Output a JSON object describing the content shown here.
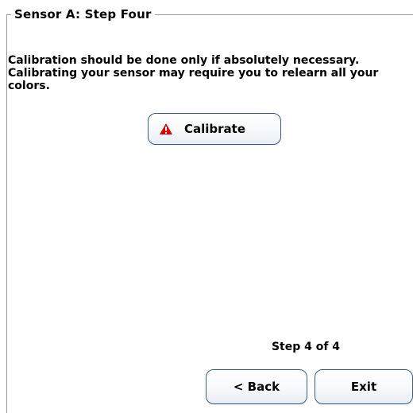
{
  "groupbox": {
    "title": "Sensor A: Step Four"
  },
  "content": {
    "description": "Calibration should be done only if absolutely necessary. Calibrating your sensor may require you to relearn all your colors."
  },
  "calibrate_button": {
    "icon": "warning-icon",
    "icon_color": "#e00000",
    "label": "Calibrate"
  },
  "footer": {
    "step_text": "Step 4 of 4",
    "back_label": "< Back",
    "exit_label": "Exit"
  }
}
